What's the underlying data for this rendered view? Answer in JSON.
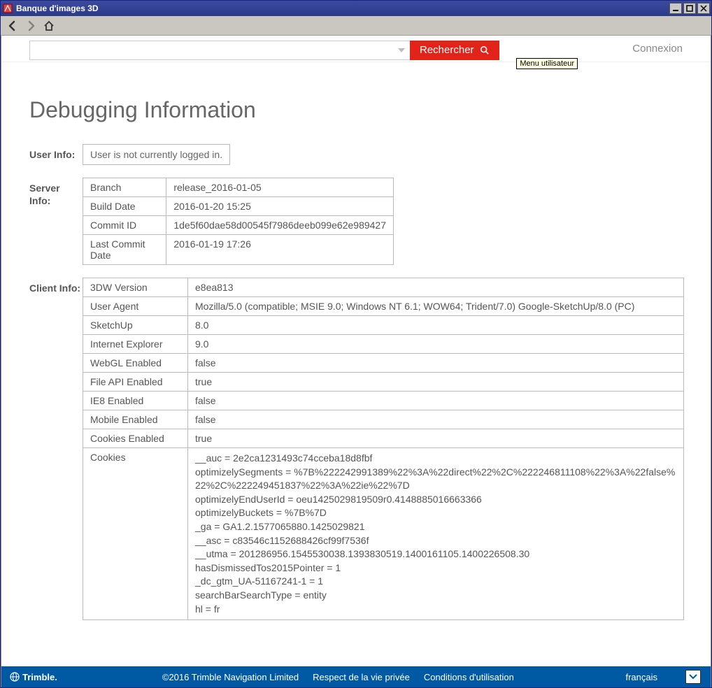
{
  "window": {
    "title": "Banque d'images 3D"
  },
  "header": {
    "search_button": "Rechercher",
    "login": "Connexion",
    "tooltip": "Menu utilisateur"
  },
  "page": {
    "title": "Debugging Information",
    "user_info_label": "User Info:",
    "user_info_value": "User is not currently logged in.",
    "server_info_label": "Server Info:",
    "client_info_label": "Client Info:"
  },
  "server_info": [
    {
      "k": "Branch",
      "v": "release_2016-01-05"
    },
    {
      "k": "Build Date",
      "v": "2016-01-20 15:25"
    },
    {
      "k": "Commit ID",
      "v": "1de5f60dae58d00545f7986deeb099e62e989427"
    },
    {
      "k": "Last Commit Date",
      "v": "2016-01-19 17:26"
    }
  ],
  "client_info": [
    {
      "k": "3DW Version",
      "v": "e8ea813"
    },
    {
      "k": "User Agent",
      "v": "Mozilla/5.0 (compatible; MSIE 9.0; Windows NT 6.1; WOW64; Trident/7.0) Google-SketchUp/8.0 (PC)"
    },
    {
      "k": "SketchUp",
      "v": "8.0"
    },
    {
      "k": "Internet Explorer",
      "v": "9.0"
    },
    {
      "k": "WebGL Enabled",
      "v": "false"
    },
    {
      "k": "File API Enabled",
      "v": "true"
    },
    {
      "k": "IE8 Enabled",
      "v": "false"
    },
    {
      "k": "Mobile Enabled",
      "v": "false"
    },
    {
      "k": "Cookies Enabled",
      "v": "true"
    }
  ],
  "cookies_label": "Cookies",
  "cookies": [
    "__auc = 2e2ca1231493c74cceba18d8fbf",
    "optimizelySegments = %7B%222242991389%22%3A%22direct%22%2C%222246811108%22%3A%22false%22%2C%222249451837%22%3A%22ie%22%7D",
    "optimizelyEndUserId = oeu1425029819509r0.4148885016663366",
    "optimizelyBuckets = %7B%7D",
    "_ga = GA1.2.1577065880.1425029821",
    "__asc = c83546c1152688426cf99f7536f",
    "__utma = 201286956.1545530038.1393830519.1400161105.1400226508.30",
    "hasDismissedTos2015Pointer = 1",
    "_dc_gtm_UA-51167241-1 = 1",
    "searchBarSearchType = entity",
    "hl = fr"
  ],
  "footer": {
    "brand": "Trimble.",
    "copyright": "©2016 Trimble Navigation Limited",
    "privacy": "Respect de la vie privée",
    "terms": "Conditions d'utilisation",
    "language": "français"
  }
}
